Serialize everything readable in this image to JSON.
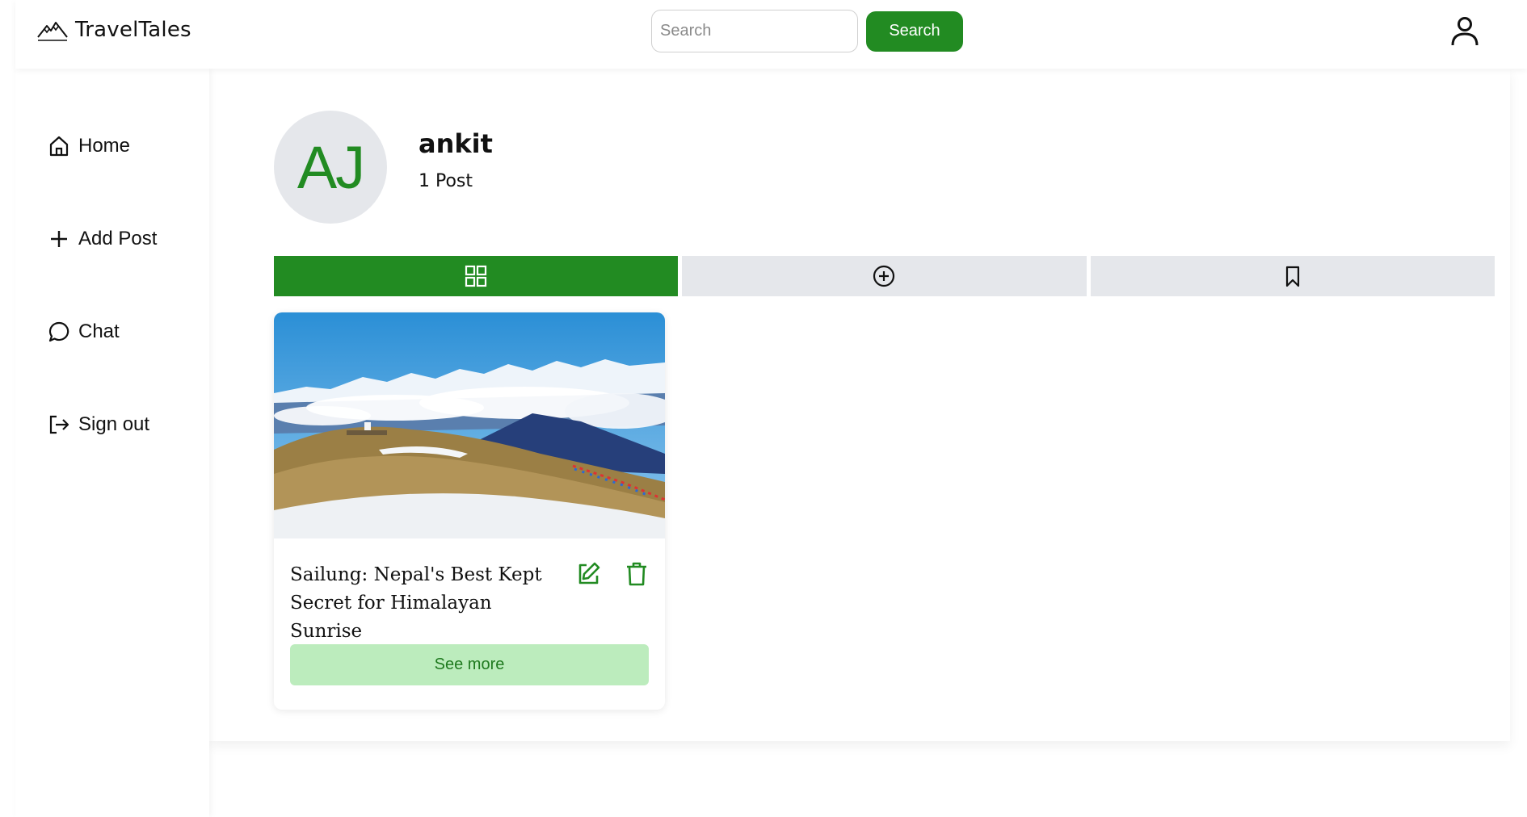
{
  "header": {
    "brand_name": "TravelTales",
    "brand_icon": "mountain-icon",
    "search_placeholder": "Search",
    "search_value": "",
    "search_button_label": "Search",
    "user_icon": "user-icon"
  },
  "sidebar": {
    "items": [
      {
        "label": "Home",
        "icon": "home-icon"
      },
      {
        "label": "Add Post",
        "icon": "plus-icon"
      },
      {
        "label": "Chat",
        "icon": "chat-bubble-icon"
      },
      {
        "label": "Sign out",
        "icon": "sign-out-icon"
      }
    ]
  },
  "profile": {
    "initials": "AJ",
    "name": "ankit",
    "post_count_label": "1 Post"
  },
  "tabs": [
    {
      "icon": "grid-icon",
      "active": true
    },
    {
      "icon": "plus-circle-icon",
      "active": false
    },
    {
      "icon": "bookmark-icon",
      "active": false
    }
  ],
  "posts": [
    {
      "title": "Sailung: Nepal's Best Kept Secret for Himalayan Sunrise",
      "image": "mountain-landscape-photo",
      "see_more_label": "See more"
    }
  ],
  "colors": {
    "accent": "#228b22",
    "tab_inactive": "#e5e7eb",
    "see_more_bg": "#bcecbd",
    "avatar_bg": "#e5e7eb"
  }
}
